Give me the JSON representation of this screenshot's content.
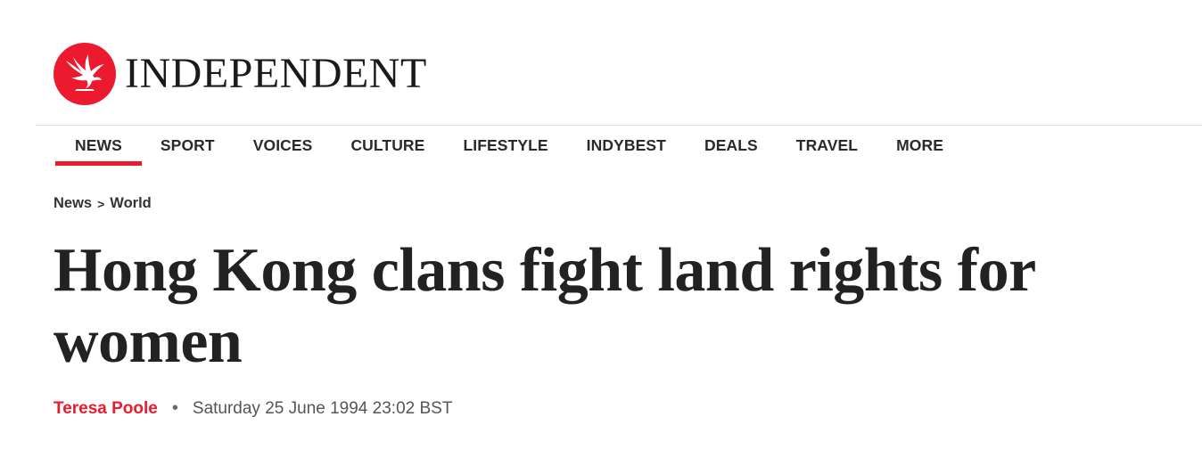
{
  "brand": {
    "name": "INDEPENDENT",
    "logo_icon": "eagle-icon",
    "brand_color": "#ec1a2e"
  },
  "nav": {
    "items": [
      {
        "label": "NEWS",
        "active": true
      },
      {
        "label": "SPORT"
      },
      {
        "label": "VOICES"
      },
      {
        "label": "CULTURE"
      },
      {
        "label": "LIFESTYLE"
      },
      {
        "label": "INDYBEST"
      },
      {
        "label": "DEALS"
      },
      {
        "label": "TRAVEL"
      },
      {
        "label": "MORE"
      }
    ]
  },
  "breadcrumb": {
    "section": "News",
    "separator": ">",
    "subsection": "World"
  },
  "article": {
    "headline": "Hong Kong clans fight land rights for women",
    "author": "Teresa Poole",
    "bullet": "•",
    "date": "Saturday 25 June 1994 23:02 BST"
  }
}
